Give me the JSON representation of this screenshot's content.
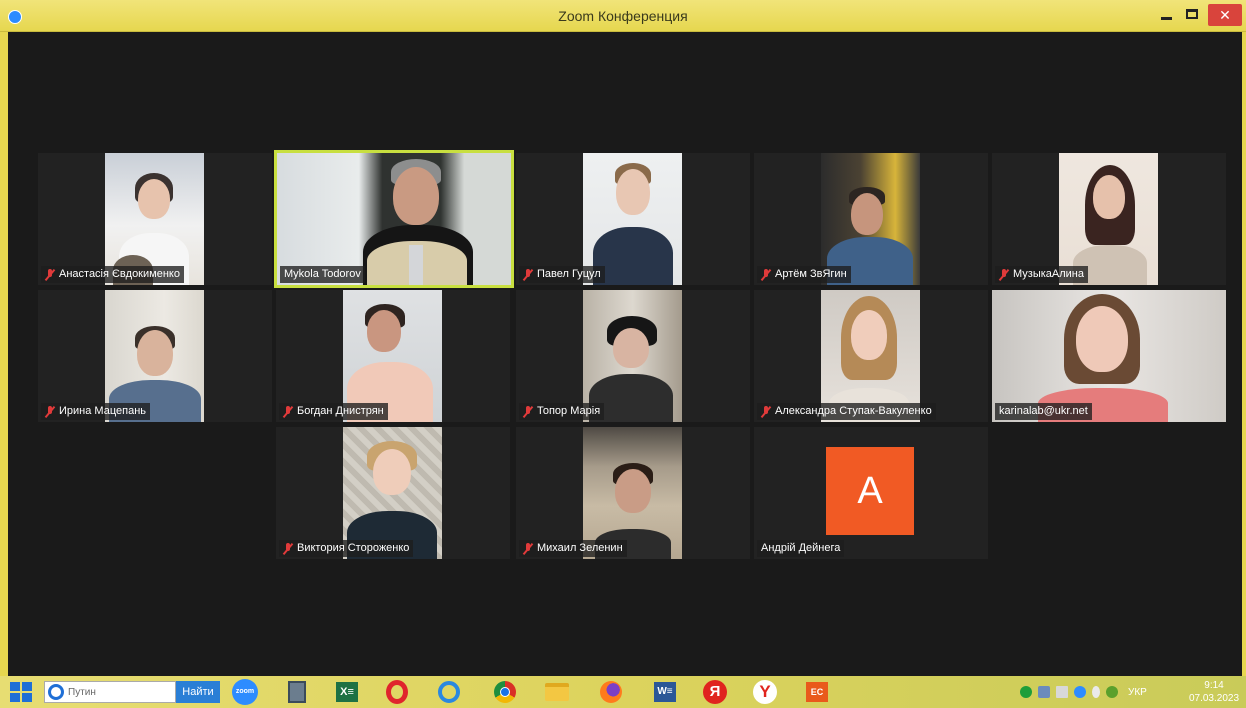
{
  "window": {
    "title": "Zoom Конференция",
    "minimize": "–",
    "close": "✕"
  },
  "participants": [
    {
      "name": "Анастасія Євдокименко",
      "muted": true
    },
    {
      "name": "Mykola Todorov",
      "muted": false,
      "active_speaker": true
    },
    {
      "name": "Павел Гуцул",
      "muted": true
    },
    {
      "name": "Артём ЗвЯгин",
      "muted": true
    },
    {
      "name": "МузыкаАлина",
      "muted": true
    },
    {
      "name": "Ирина Мацепань",
      "muted": true
    },
    {
      "name": "Богдан Днистрян",
      "muted": true
    },
    {
      "name": "Топор Марія",
      "muted": true
    },
    {
      "name": "Александра Ступак-Вакуленко",
      "muted": true
    },
    {
      "name": "karinalab@ukr.net",
      "muted": false
    },
    {
      "name": "Виктория Стороженко",
      "muted": true
    },
    {
      "name": "Михаил Зеленин",
      "muted": true
    },
    {
      "name": "Андрій Дейнега",
      "muted": false,
      "avatar_letter": "A",
      "avatar_color": "#f15a24"
    }
  ],
  "taskbar": {
    "search_placeholder": "Путин",
    "search_button": "Найти",
    "zoom_label": "zoom",
    "excel_label": "X≡",
    "word_label": "W≡",
    "yandex_label": "Я",
    "yandex_browser_label": "Y",
    "ec_label": "EC",
    "language": "УКР",
    "time": "9:14",
    "date": "07.03.2023"
  },
  "colors": {
    "titlebar": "#e6d74f",
    "active_speaker_border": "#c8df40",
    "close_button": "#d9443c",
    "avatar": "#f15a24"
  }
}
